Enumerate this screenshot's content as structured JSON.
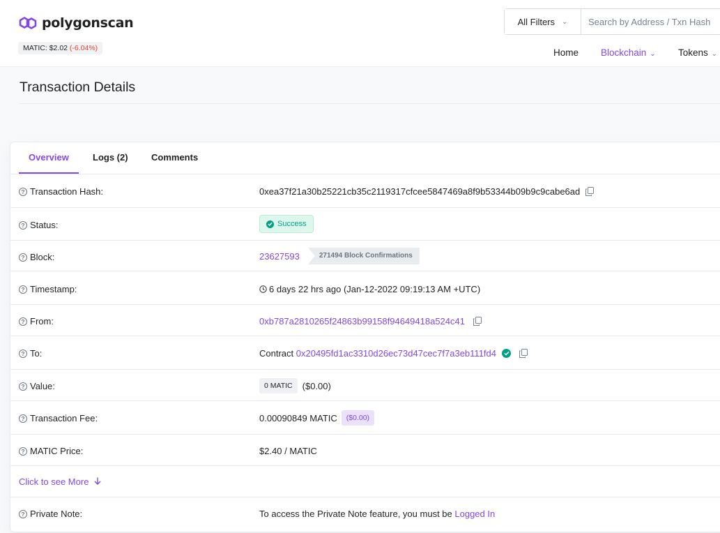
{
  "brand": {
    "name": "polygonscan",
    "price_label": "MATIC: $2.02",
    "price_change": "(-6.04%)",
    "accent": "#8247e5",
    "negative": "#de4437"
  },
  "search": {
    "filter_label": "All Filters",
    "placeholder": "Search by Address / Txn Hash / Block / Token / Ens"
  },
  "nav": {
    "home": "Home",
    "blockchain": "Blockchain",
    "tokens": "Tokens"
  },
  "page": {
    "title": "Transaction Details"
  },
  "tabs": {
    "overview": "Overview",
    "logs": "Logs (2)",
    "comments": "Comments"
  },
  "details": {
    "tx_hash": {
      "label": "Transaction Hash:",
      "value": "0xea37f21a30b25221cb35c2119317cfcee5847469a8f9b53344b09b9c9cabe6ad"
    },
    "status": {
      "label": "Status:",
      "value": "Success"
    },
    "block": {
      "label": "Block:",
      "value": "23627593",
      "confirmations": "271494 Block Confirmations"
    },
    "timestamp": {
      "label": "Timestamp:",
      "value": "6 days 22 hrs ago (Jan-12-2022 09:19:13 AM +UTC)"
    },
    "from": {
      "label": "From:",
      "value": "0xb787a2810265f24863b99158f94649418a524c41"
    },
    "to": {
      "label": "To:",
      "prefix": "Contract",
      "value": "0x20495fd1ac3310d26ec73d47cec7f7a3eb111fd4"
    },
    "value": {
      "label": "Value:",
      "amount": "0 MATIC",
      "usd": "($0.00)"
    },
    "fee": {
      "label": "Transaction Fee:",
      "amount": "0.00090849 MATIC",
      "usd": "($0.00)"
    },
    "price": {
      "label": "MATIC Price:",
      "value": "$2.40 / MATIC"
    },
    "more": "Click to see More",
    "note": {
      "label": "Private Note:",
      "text": "To access the Private Note feature, you must be",
      "link": "Logged In"
    }
  },
  "icons": {
    "help": "question-circle-icon",
    "copy": "copy-icon",
    "check": "check-circle-icon",
    "clock": "clock-icon",
    "arrow": "arrow-down-icon"
  }
}
